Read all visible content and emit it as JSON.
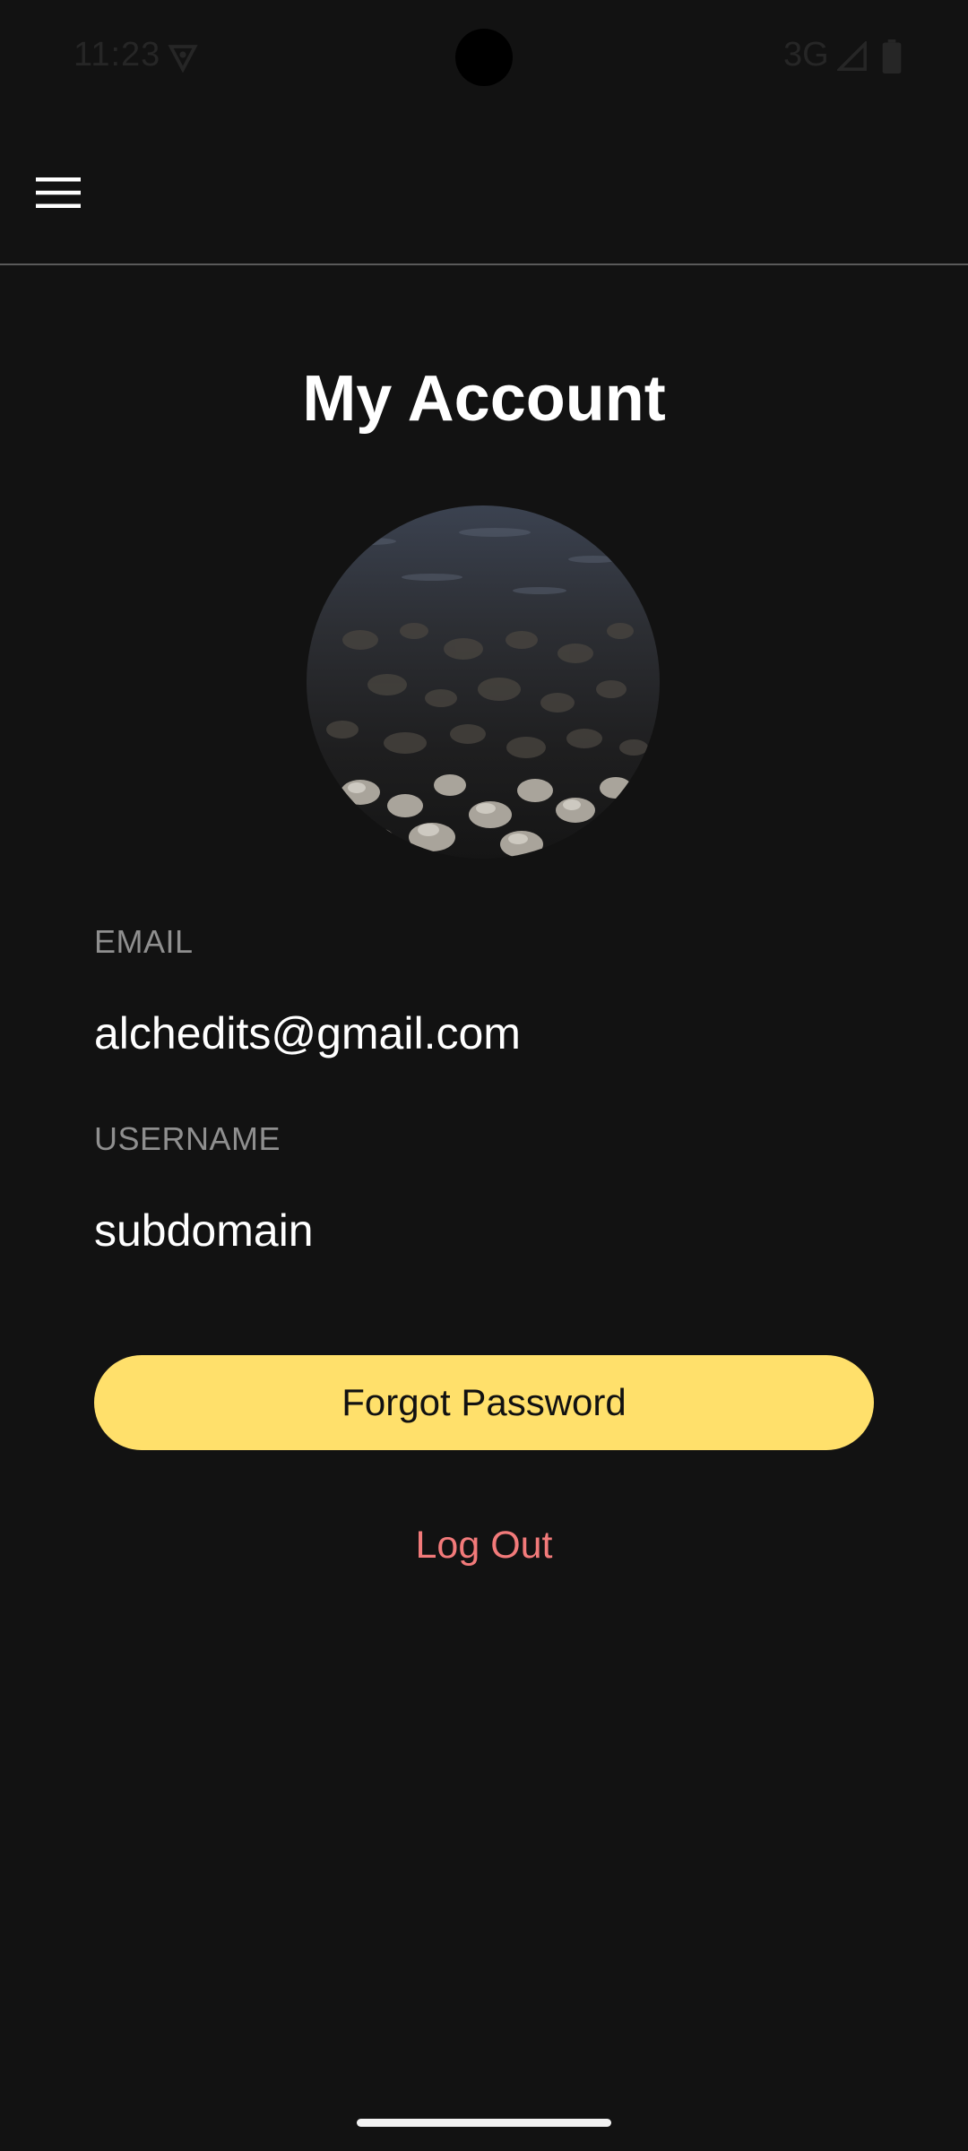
{
  "status_bar": {
    "time": "11:23",
    "network": "3G",
    "icons": [
      "vpn-shield-icon",
      "signal-icon",
      "battery-icon"
    ]
  },
  "app_bar": {
    "menu_icon": "hamburger-menu-icon"
  },
  "page": {
    "title": "My Account",
    "avatar_icon": "profile-photo-pebbles"
  },
  "fields": {
    "email_label": "EMAIL",
    "email_value": "alchedits@gmail.com",
    "username_label": "USERNAME",
    "username_value": "subdomain"
  },
  "actions": {
    "forgot_password": "Forgot Password",
    "log_out": "Log Out"
  },
  "colors": {
    "background": "#121212",
    "primary_button": "#ffe06b",
    "logout_text": "#f27a7a",
    "label_text": "#8f8f8f"
  }
}
